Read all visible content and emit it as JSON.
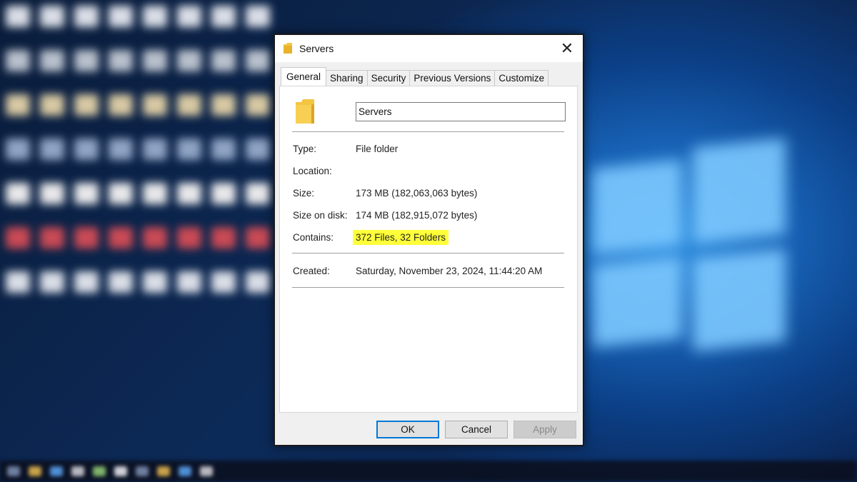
{
  "dialog": {
    "title": "Servers",
    "close_glyph": "✕",
    "tabs": [
      {
        "label": "General",
        "active": true
      },
      {
        "label": "Sharing",
        "active": false
      },
      {
        "label": "Security",
        "active": false
      },
      {
        "label": "Previous Versions",
        "active": false
      },
      {
        "label": "Customize",
        "active": false
      }
    ],
    "general": {
      "name_value": "Servers",
      "rows": [
        {
          "label": "Type:",
          "value": "File folder"
        },
        {
          "label": "Location:",
          "value": ""
        },
        {
          "label": "Size:",
          "value": "173 MB (182,063,063 bytes)"
        },
        {
          "label": "Size on disk:",
          "value": "174 MB (182,915,072 bytes)"
        },
        {
          "label": "Contains:",
          "value": "372 Files, 32 Folders",
          "highlighted": true
        },
        {
          "label": "Created:",
          "value": "Saturday, November 23, 2024, 11:44:20 AM"
        }
      ]
    },
    "buttons": {
      "ok": "OK",
      "cancel": "Cancel",
      "apply": "Apply",
      "apply_disabled": true
    }
  },
  "colors": {
    "folder_yellow": "#f4c541",
    "highlight_yellow": "#ffff3a",
    "focus_blue": "#0078d7",
    "desktop_blue": "#1760b3"
  },
  "icons": {
    "title": "folder-icon",
    "close": "close-icon",
    "folder_large": "folder-icon"
  }
}
